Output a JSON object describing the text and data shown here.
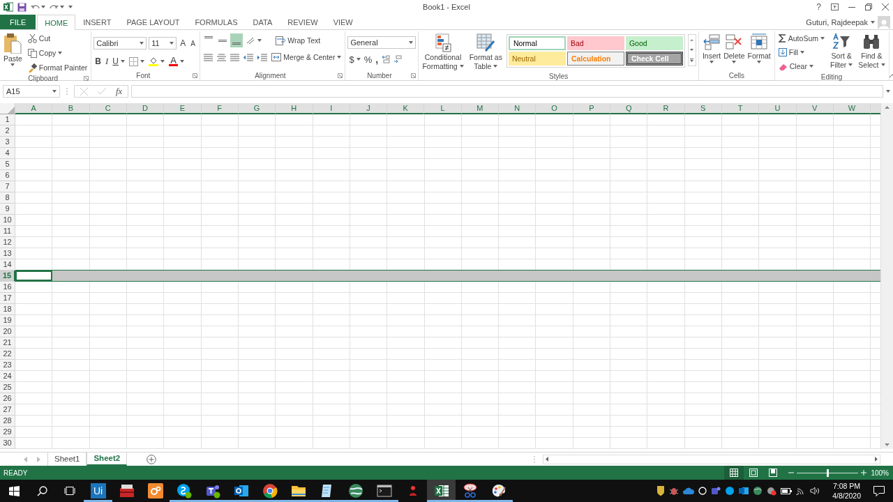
{
  "title_bar": {
    "title": "Book1 - Excel",
    "help": "?"
  },
  "tabs": [
    {
      "label": "FILE",
      "kind": "file",
      "selected": false
    },
    {
      "label": "HOME",
      "kind": "tab",
      "selected": true
    },
    {
      "label": "INSERT",
      "kind": "tab",
      "selected": false
    },
    {
      "label": "PAGE LAYOUT",
      "kind": "tab",
      "selected": false
    },
    {
      "label": "FORMULAS",
      "kind": "tab",
      "selected": false
    },
    {
      "label": "DATA",
      "kind": "tab",
      "selected": false
    },
    {
      "label": "REVIEW",
      "kind": "tab",
      "selected": false
    },
    {
      "label": "VIEW",
      "kind": "tab",
      "selected": false
    }
  ],
  "user": {
    "name": "Guturi, Rajdeepak"
  },
  "ribbon": {
    "clipboard": {
      "label": "Clipboard",
      "paste": "Paste",
      "cut": "Cut",
      "copy": "Copy",
      "painter": "Format Painter"
    },
    "font": {
      "label": "Font",
      "family": "Calibri",
      "size": "11",
      "grow": "A",
      "shrink": "A",
      "bold": "B",
      "italic": "I",
      "underline": "U",
      "color_letter": "A"
    },
    "alignment": {
      "label": "Alignment",
      "vertical": [
        {
          "kind": "top",
          "selected": false
        },
        {
          "kind": "middle",
          "selected": false
        },
        {
          "kind": "bottom",
          "selected": true
        }
      ],
      "wrap": "Wrap Text",
      "merge": "Merge & Center"
    },
    "number": {
      "label": "Number",
      "format": "General",
      "currency": "$",
      "percent": "%",
      "comma": ","
    },
    "styles": {
      "label": "Styles",
      "conditional": [
        "Conditional",
        "Formatting"
      ],
      "table": [
        "Format as",
        "Table"
      ],
      "cells": [
        {
          "label": "Normal",
          "kind": "normal"
        },
        {
          "label": "Bad",
          "kind": "bad"
        },
        {
          "label": "Good",
          "kind": "good"
        },
        {
          "label": "Neutral",
          "kind": "neutral"
        },
        {
          "label": "Calculation",
          "kind": "calculation"
        },
        {
          "label": "Check Cell",
          "kind": "check"
        }
      ]
    },
    "cells": {
      "label": "Cells",
      "buttons": [
        {
          "label": "Insert",
          "kind": "insert"
        },
        {
          "label": "Delete",
          "kind": "delete"
        },
        {
          "label": "Format",
          "kind": "format"
        }
      ]
    },
    "editing": {
      "label": "Editing",
      "autosum": "AutoSum",
      "fill": "Fill",
      "clear": "Clear",
      "sort": [
        "Sort &",
        "Filter"
      ],
      "find": [
        "Find &",
        "Select"
      ]
    }
  },
  "formula_bar": {
    "name_box": "A15",
    "fx": "fx"
  },
  "columns": [
    "A",
    "B",
    "C",
    "D",
    "E",
    "F",
    "G",
    "H",
    "I",
    "J",
    "K",
    "L",
    "M",
    "N",
    "O",
    "P",
    "Q",
    "R",
    "S",
    "T",
    "U",
    "V",
    "W"
  ],
  "rows": [
    {
      "label": "1",
      "selected": false
    },
    {
      "label": "2",
      "selected": false
    },
    {
      "label": "3",
      "selected": false
    },
    {
      "label": "4",
      "selected": false
    },
    {
      "label": "5",
      "selected": false
    },
    {
      "label": "6",
      "selected": false
    },
    {
      "label": "7",
      "selected": false
    },
    {
      "label": "8",
      "selected": false
    },
    {
      "label": "9",
      "selected": false
    },
    {
      "label": "10",
      "selected": false
    },
    {
      "label": "11",
      "selected": false
    },
    {
      "label": "12",
      "selected": false
    },
    {
      "label": "13",
      "selected": false
    },
    {
      "label": "14",
      "selected": false
    },
    {
      "label": "15",
      "selected": true
    },
    {
      "label": "16",
      "selected": false
    },
    {
      "label": "17",
      "selected": false
    },
    {
      "label": "18",
      "selected": false
    },
    {
      "label": "19",
      "selected": false
    },
    {
      "label": "20",
      "selected": false
    },
    {
      "label": "21",
      "selected": false
    },
    {
      "label": "22",
      "selected": false
    },
    {
      "label": "23",
      "selected": false
    },
    {
      "label": "24",
      "selected": false
    },
    {
      "label": "25",
      "selected": false
    },
    {
      "label": "26",
      "selected": false
    },
    {
      "label": "27",
      "selected": false
    },
    {
      "label": "28",
      "selected": false
    },
    {
      "label": "29",
      "selected": false
    },
    {
      "label": "30",
      "selected": false
    }
  ],
  "sheets": [
    {
      "label": "Sheet1",
      "selected": false
    },
    {
      "label": "Sheet2",
      "selected": true
    }
  ],
  "status_bar": {
    "status": "READY",
    "views": [
      {
        "kind": "normal",
        "selected": true
      },
      {
        "kind": "page_layout",
        "selected": false
      },
      {
        "kind": "page_break",
        "selected": false
      }
    ],
    "zoom": {
      "level": 0.5,
      "reading": "100%"
    }
  },
  "taskbar": {
    "apps": [
      {
        "kind": "ui",
        "text": "Ui",
        "running": true,
        "selected": false
      },
      {
        "kind": "toolbox",
        "running": false,
        "selected": false
      },
      {
        "kind": "gears",
        "running": false,
        "selected": false
      },
      {
        "kind": "chat",
        "running": true,
        "selected": false
      },
      {
        "kind": "team",
        "running": true,
        "selected": false
      },
      {
        "kind": "mail",
        "running": true,
        "selected": false
      },
      {
        "kind": "browser",
        "running": true,
        "selected": false
      },
      {
        "kind": "folder",
        "running": true,
        "selected": false
      },
      {
        "kind": "notepad",
        "running": true,
        "selected": false
      },
      {
        "kind": "globe",
        "running": true,
        "selected": false
      },
      {
        "kind": "terminal",
        "running": true,
        "selected": false
      },
      {
        "kind": "figure",
        "running": false,
        "selected": false
      },
      {
        "kind": "sheet",
        "running": true,
        "selected": true
      },
      {
        "kind": "scissors",
        "running": true,
        "selected": false
      },
      {
        "kind": "palette",
        "running": true,
        "selected": false
      }
    ],
    "time": "7:08 PM",
    "date": "4/8/2020"
  }
}
